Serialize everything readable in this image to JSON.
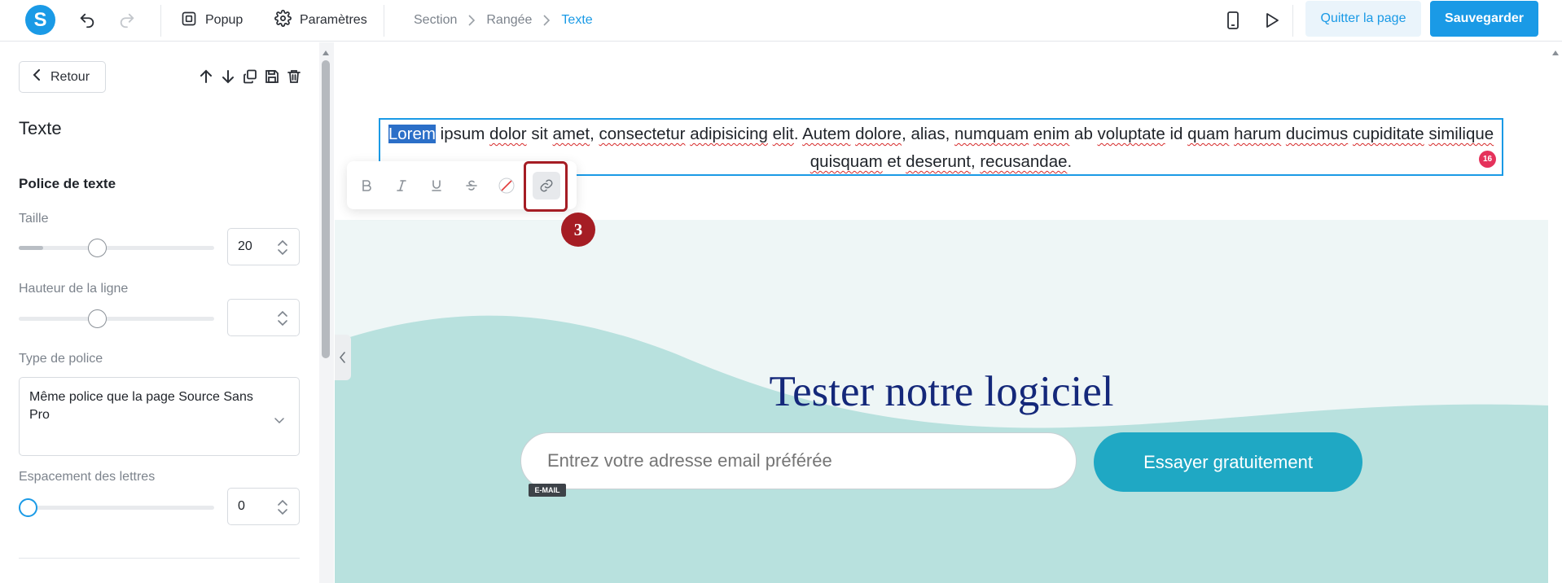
{
  "topbar": {
    "logo_letter": "S",
    "popup_label": "Popup",
    "settings_label": "Paramètres",
    "breadcrumb": [
      "Section",
      "Rangée",
      "Texte"
    ],
    "quit_label": "Quitter la page",
    "save_label": "Sauvegarder"
  },
  "panel": {
    "back_label": "Retour",
    "title": "Texte",
    "section_title": "Police de texte",
    "size_label": "Taille",
    "size_value": "20",
    "size_fraction": 0.4,
    "line_height_label": "Hauteur de la ligne",
    "line_height_value": "",
    "line_height_fraction": 0.4,
    "font_type_label": "Type de police",
    "font_type_value": "Même police que la page Source Sans Pro",
    "letter_spacing_label": "Espacement des lettres",
    "letter_spacing_value": "0",
    "letter_spacing_fraction": 0.0
  },
  "canvas": {
    "text_selected": "Lorem",
    "text_rest": "ipsum dolor sit amet, consectetur adipisicing elit. Autem dolore, alias, numquam enim ab voluptate id quam harum ducimus cupiditate similique quisquam et deserunt, recusandae.",
    "char_count_badge": "16",
    "step_badge": "3",
    "cta_title": "Tester notre logiciel",
    "email_placeholder": "Entrez votre adresse email préférée",
    "email_tag": "E-MAIL",
    "cta_button": "Essayer gratuitement"
  },
  "colors": {
    "accent": "#1a9ae6",
    "highlight_red": "#a51d24",
    "cta_title": "#14287a",
    "cta_button": "#1fa8c4",
    "wave": "#b8e1de"
  }
}
